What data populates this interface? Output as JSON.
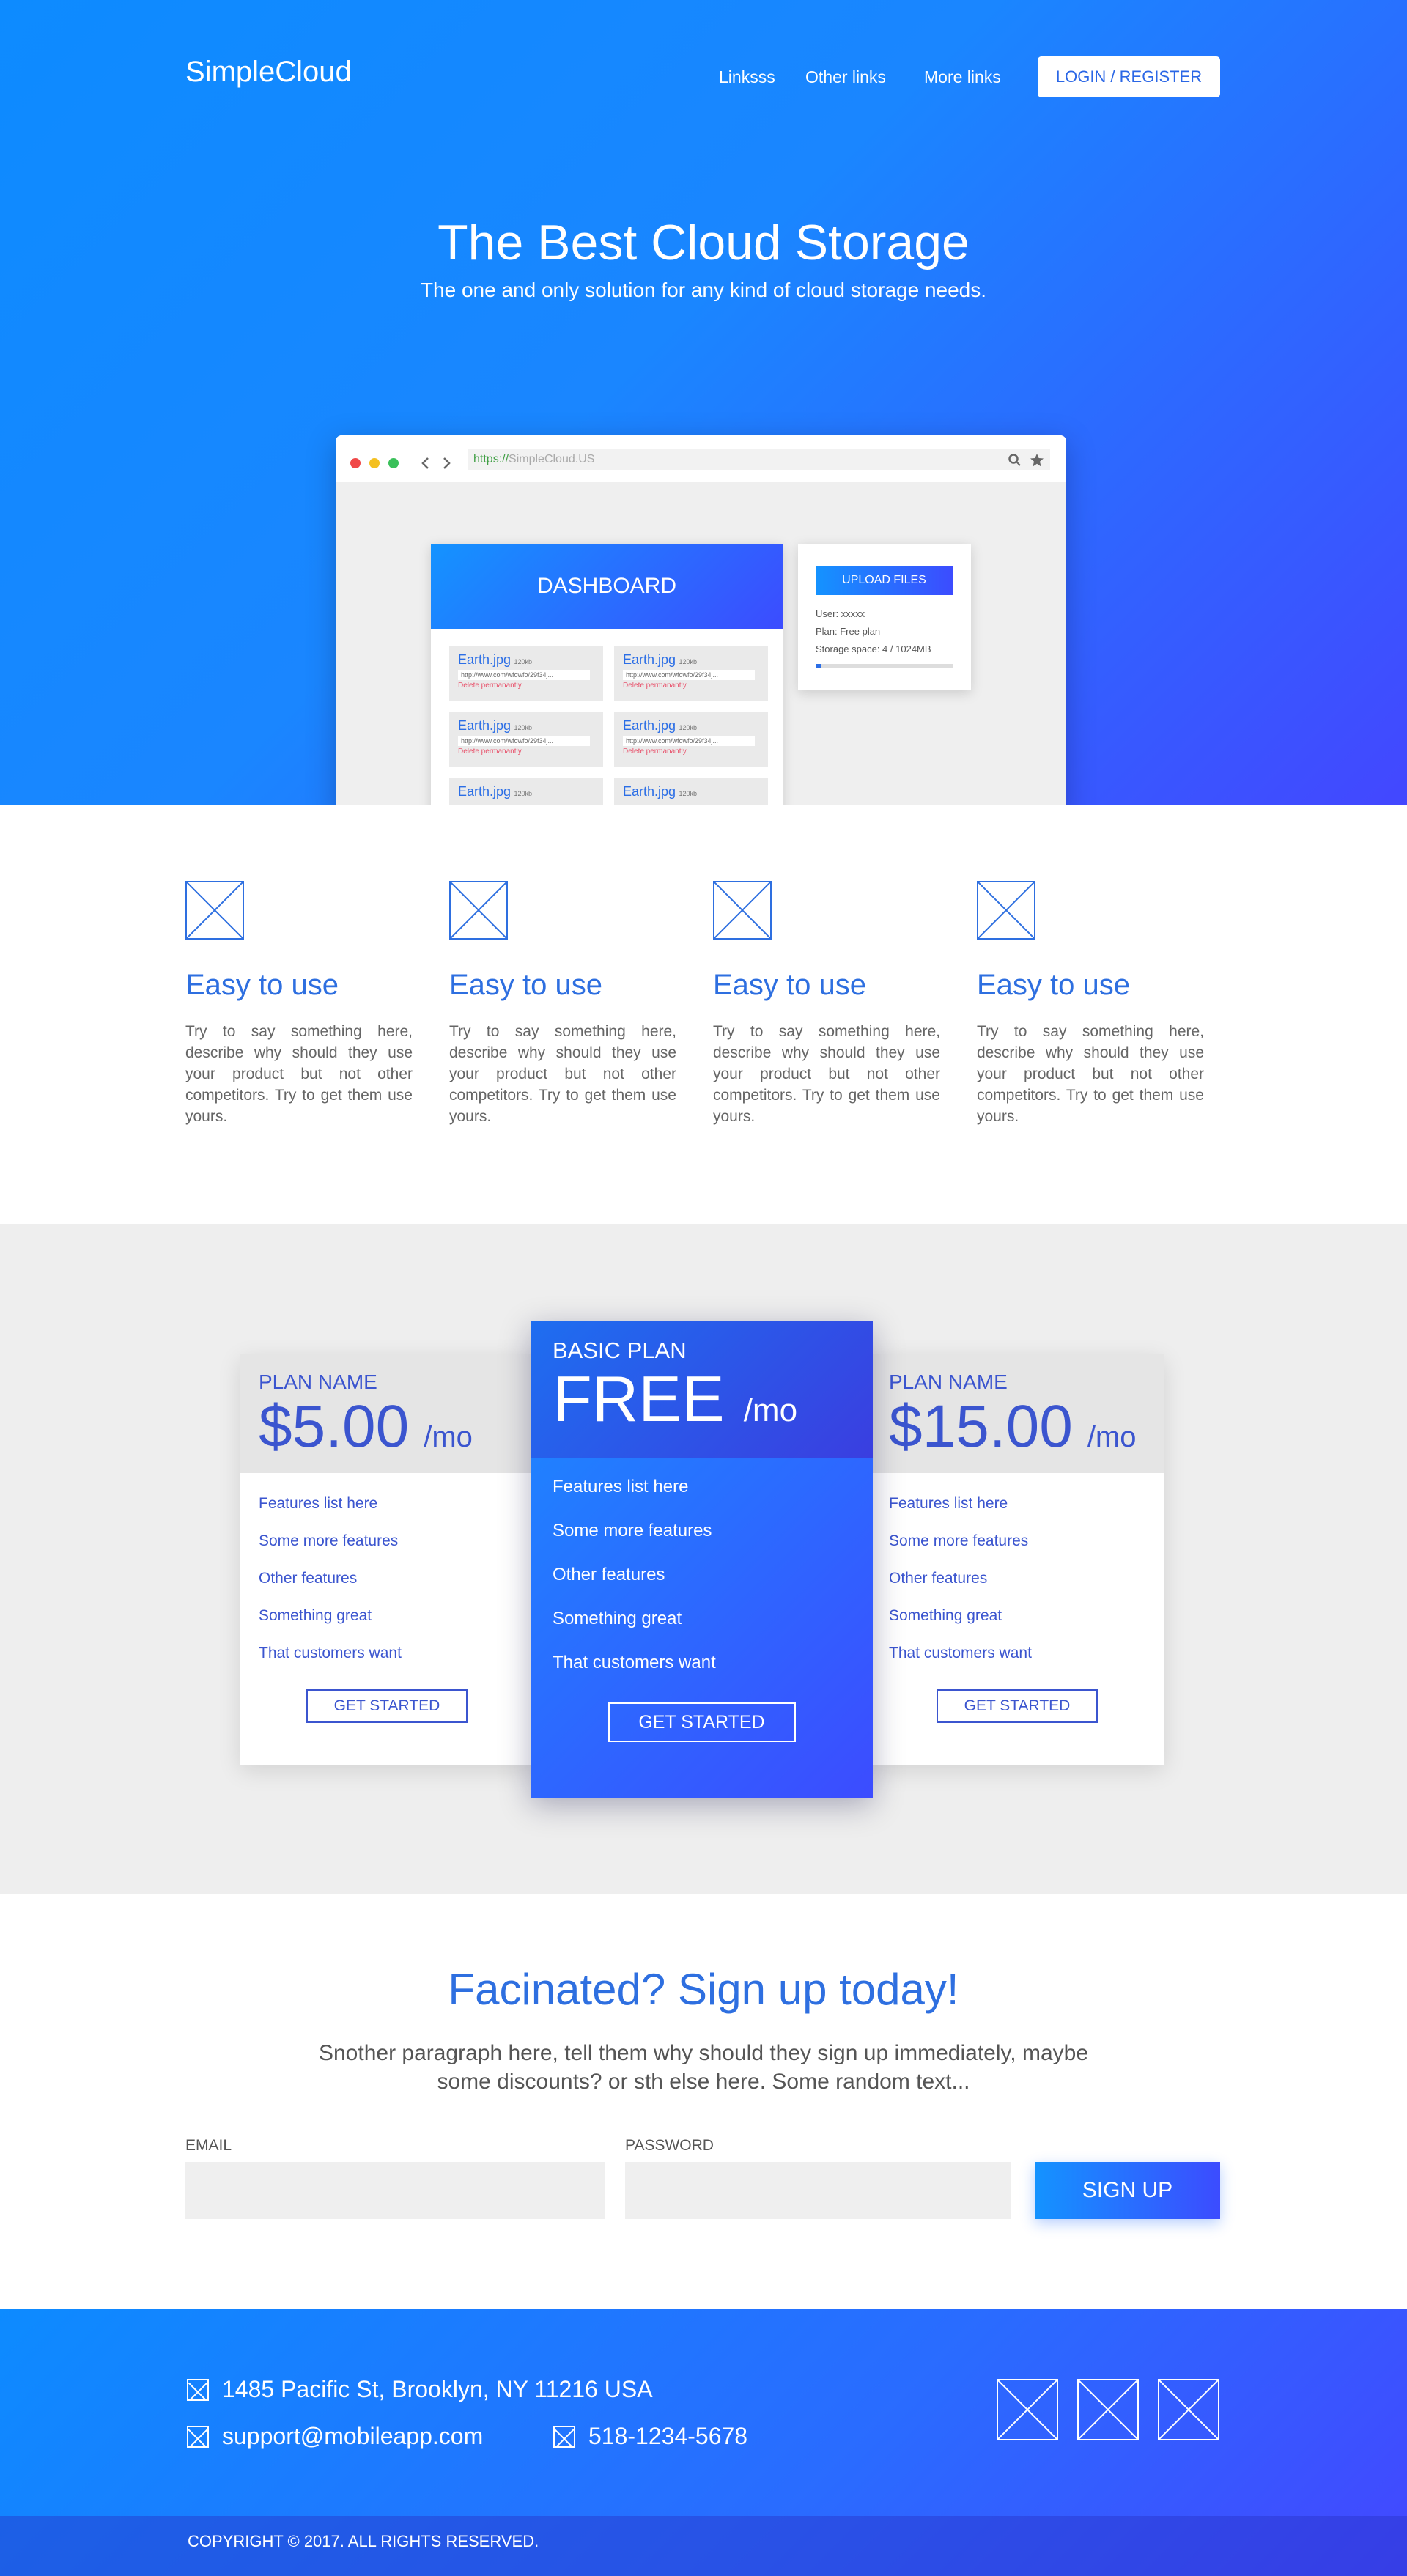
{
  "header": {
    "logo": "SimpleCloud",
    "nav": [
      "Linksss",
      "Other links",
      "More links"
    ],
    "login_label": "LOGIN / REGISTER"
  },
  "hero": {
    "title": "The Best Cloud Storage",
    "subtitle": "The one and only solution for any kind of cloud storage needs."
  },
  "browser": {
    "url_scheme": "https://",
    "url_host": "SimpleCloud.US",
    "dashboard_title": "DASHBOARD",
    "files": [
      {
        "name": "Earth.jpg",
        "size": "120kb",
        "link": "http://www.com/wfowfo/29f34j...",
        "delete": "Delete permanantly"
      },
      {
        "name": "Earth.jpg",
        "size": "120kb",
        "link": "http://www.com/wfowfo/29f34j...",
        "delete": "Delete permanantly"
      },
      {
        "name": "Earth.jpg",
        "size": "120kb",
        "link": "http://www.com/wfowfo/29f34j...",
        "delete": "Delete permanantly"
      },
      {
        "name": "Earth.jpg",
        "size": "120kb",
        "link": "http://www.com/wfowfo/29f34j...",
        "delete": "Delete permanantly"
      },
      {
        "name": "Earth.jpg",
        "size": "120kb",
        "link": "",
        "delete": ""
      },
      {
        "name": "Earth.jpg",
        "size": "120kb",
        "link": "",
        "delete": ""
      }
    ],
    "upload_label": "UPLOAD FILES",
    "user": "User: xxxxx",
    "plan": "Plan: Free plan",
    "storage": "Storage space: 4 / 1024MB",
    "storage_fraction": 0.04
  },
  "features": [
    {
      "title": "Easy to use",
      "text": "Try to say something here, describe why should they use your product but not other competitors. Try to get them use yours."
    },
    {
      "title": "Easy to use",
      "text": "Try to say something here, describe why should they use your product but not other competitors. Try to get them use yours."
    },
    {
      "title": "Easy to use",
      "text": "Try to say something here, describe why should they use your product but not other competitors. Try to get them use yours."
    },
    {
      "title": "Easy to use",
      "text": "Try to say something here, describe why should they use your product but not other competitors. Try to get them use yours."
    }
  ],
  "pricing": {
    "left": {
      "name": "PLAN NAME",
      "price": "$5.00",
      "period": "/mo",
      "features": [
        "Features list here",
        "Some more features",
        "Other features",
        "Something great",
        "That customers want"
      ],
      "button": "GET STARTED"
    },
    "middle": {
      "name": "BASIC PLAN",
      "price": "FREE",
      "period": "/mo",
      "features": [
        "Features list here",
        "Some more features",
        "Other features",
        "Something great",
        "That customers want"
      ],
      "button": "GET STARTED"
    },
    "right": {
      "name": "PLAN NAME",
      "price": "$15.00",
      "period": "/mo",
      "features": [
        "Features list here",
        "Some more features",
        "Other features",
        "Something great",
        "That customers want"
      ],
      "button": "GET STARTED"
    }
  },
  "cta": {
    "title": "Facinated? Sign up today!",
    "paragraph_line1": "Snother paragraph here, tell them why should they sign up immediately, maybe",
    "paragraph_line2": "some discounts? or sth else here. Some random text...",
    "email_label": "EMAIL",
    "password_label": "PASSWORD",
    "signup_label": "SIGN UP"
  },
  "footer": {
    "address": "1485 Pacific St, Brooklyn, NY 11216 USA",
    "email": "support@mobileapp.com",
    "phone": "518-1234-5678",
    "copyright": "COPYRIGHT © 2017. ALL RIGHTS RESERVED."
  }
}
